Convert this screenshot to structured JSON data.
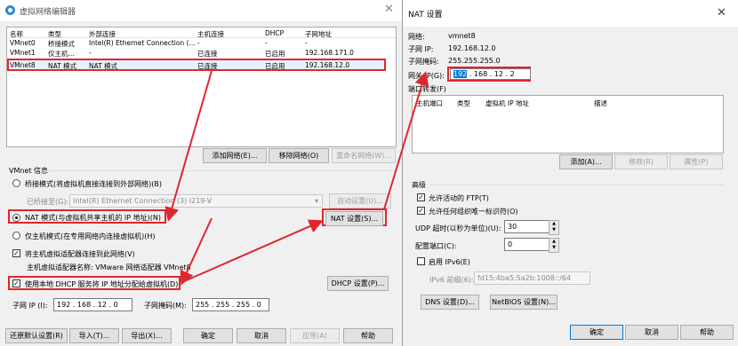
{
  "left": {
    "title": "虚拟网络编辑器",
    "columns": [
      "名称",
      "类型",
      "外部连接",
      "主机连接",
      "DHCP",
      "子网地址"
    ],
    "rows": [
      [
        "VMnet0",
        "桥接模式",
        "Intel(R) Ethernet Connection (...",
        "-",
        "-",
        "-"
      ],
      [
        "VMnet1",
        "仅主机...",
        "-",
        "已连接",
        "已启用",
        "192.168.171.0"
      ],
      [
        "VMnet8",
        "NAT 模式",
        "NAT 模式",
        "已连接",
        "已启用",
        "192.168.12.0"
      ]
    ],
    "add_network": "添加网络(E)...",
    "remove_network": "移除网络(O)",
    "rename_network": "重命名网络(W)...",
    "vmnet_info": "VMnet 信息",
    "radio_bridge": "桥接模式(将虚拟机直接连接到外部网络)(B)",
    "bridged_to_label": "已桥接至(G):",
    "bridged_to_value": "Intel(R) Ethernet Connection (3) I219-V",
    "auto_settings": "自动设置(U)...",
    "radio_nat": "NAT 模式(与虚拟机共享主机的 IP 地址)(N)",
    "nat_settings": "NAT 设置(S)...",
    "radio_hostonly": "仅主机模式(在专用网络内连接虚拟机)(H)",
    "chk_connect_adapter": "将主机虚拟适配器连接到此网络(V)",
    "adapter_name": "主机虚拟适配器名称: VMware 网络适配器 VMnet8",
    "chk_dhcp": "使用本地 DHCP 服务将 IP 地址分配给虚拟机(D)",
    "dhcp_settings": "DHCP 设置(P)...",
    "subnet_ip_label": "子网 IP (I):",
    "subnet_ip": "192 . 168 . 12  .  0",
    "subnet_mask_label": "子网掩码(M):",
    "subnet_mask": "255 . 255 . 255 .  0",
    "restore": "还原默认设置(R)",
    "import": "导入(T)...",
    "export": "导出(X)...",
    "ok": "确定",
    "cancel": "取消",
    "apply": "应用(A)",
    "help": "帮助"
  },
  "right": {
    "title": "NAT 设置",
    "network_label": "网络:",
    "network_value": "vmnet8",
    "subnet_ip_label": "子网 IP:",
    "subnet_ip_value": "192.168.12.0",
    "subnet_mask_label": "子网掩码:",
    "subnet_mask_value": "255.255.255.0",
    "gateway_label": "网关 IP(G):",
    "gateway_sel": "192",
    "gateway_rest": " . 168 .  12  .  2",
    "port_forward_label": "端口转发(F)",
    "pf_columns": [
      "主机端口",
      "类型",
      "虚拟机 IP 地址",
      "描述"
    ],
    "pf_add": "添加(A)...",
    "pf_remove": "移除(R)",
    "pf_props": "属性(P)",
    "advanced": "高级",
    "chk_ftp": "允许活动的 FTP(T)",
    "chk_oui": "允许任何组织唯一标识符(O)",
    "udp_label": "UDP 超时(以秒为单位)(U):",
    "udp_value": "30",
    "config_port_label": "配置端口(C):",
    "config_port_value": "0",
    "chk_ipv6": "启用 IPv6(E)",
    "ipv6_prefix_label": "IPv6 前缀(6):",
    "ipv6_prefix_value": "fd15:4ba5:5a2b:1008::/64",
    "dns": "DNS 设置(D)...",
    "netbios": "NetBIOS 设置(N)...",
    "ok": "确定",
    "cancel": "取消",
    "help": "帮助"
  },
  "colors": {
    "highlight": "#e0262d",
    "selection": "#0078d7"
  }
}
